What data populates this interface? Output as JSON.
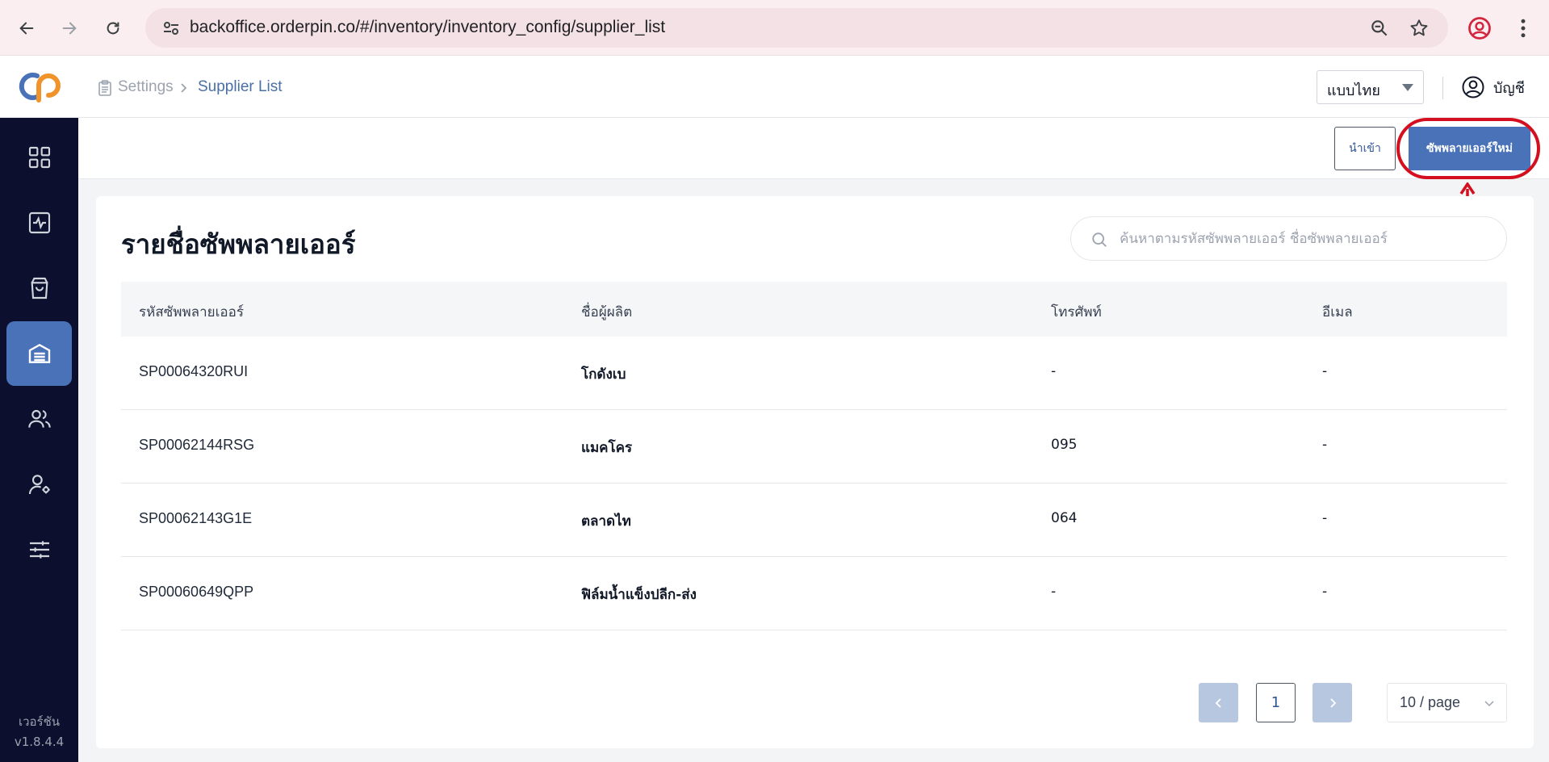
{
  "browser": {
    "url": "backoffice.orderpin.co/#/inventory/inventory_config/supplier_list"
  },
  "sidebar": {
    "logo": "CP",
    "items": [
      {
        "icon": "grid-icon"
      },
      {
        "icon": "activity-icon"
      },
      {
        "icon": "shopping-bag-icon"
      },
      {
        "icon": "warehouse-icon",
        "active": true
      },
      {
        "icon": "users-icon"
      },
      {
        "icon": "user-settings-icon"
      },
      {
        "icon": "sliders-icon"
      }
    ],
    "version_label": "เวอร์ชัน",
    "version": "v1.8.4.4"
  },
  "header": {
    "breadcrumb_parent": "Settings",
    "breadcrumb_current": "Supplier List",
    "language": "แบบไทย",
    "account_label": "บัญชี"
  },
  "toolbar": {
    "import_label": "นำเข้า",
    "new_supplier_label": "ซัพพลายเออร์ใหม่"
  },
  "page": {
    "title": "รายชื่อซัพพลายเออร์",
    "search_placeholder": "ค้นหาตามรหัสซัพพลายเออร์ ชื่อซัพพลายเออร์"
  },
  "table": {
    "headers": [
      "รหัสซัพพลายเออร์",
      "ชื่อผู้ผลิต",
      "โทรศัพท์",
      "อีเมล"
    ],
    "rows": [
      {
        "code": "SP00064320RUI",
        "name": "โกดังเบ",
        "phone": "-",
        "email": "-"
      },
      {
        "code": "SP00062144RSG",
        "name": "แมคโคร",
        "phone": "095",
        "email": "-"
      },
      {
        "code": "SP00062143G1E",
        "name": "ตลาดไท",
        "phone": "064",
        "email": "-"
      },
      {
        "code": "SP00060649QPP",
        "name": "ฟิล์มน้ำแข็งปลีก-ส่ง",
        "phone": "-",
        "email": "-"
      }
    ]
  },
  "pagination": {
    "current_page": "1",
    "page_size": "10 / page"
  },
  "colors": {
    "primary": "#4a72b8",
    "sidebar_bg": "#0c0f2d",
    "annotation_red": "#d40f1f"
  }
}
